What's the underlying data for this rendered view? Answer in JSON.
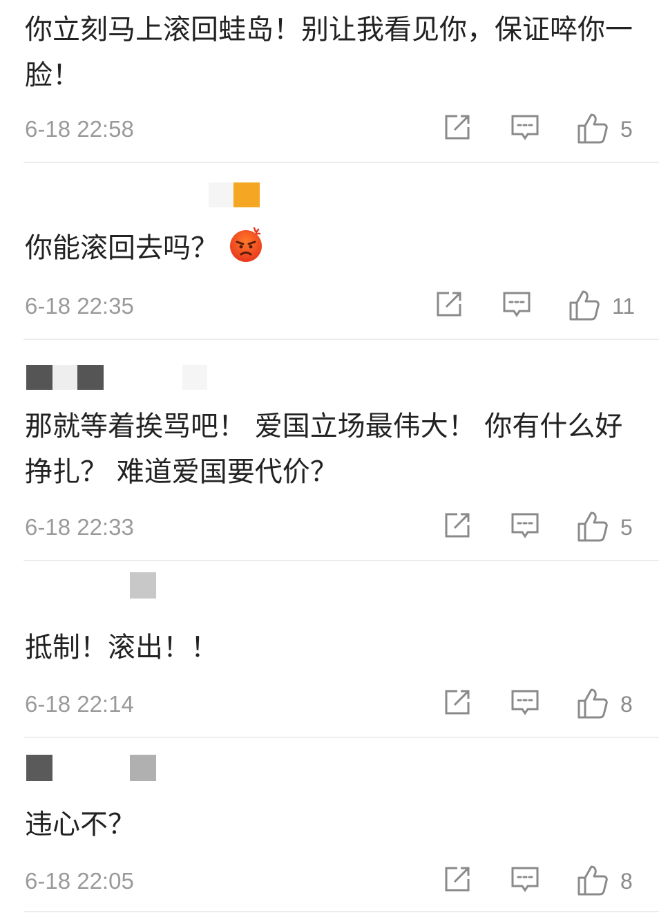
{
  "comments": [
    {
      "text": "你立刻马上滚回蛙岛！别让我看见你，保证啐你一脸！",
      "time": "6-18 22:58",
      "likes": "5"
    },
    {
      "text": "你能滚回去吗？",
      "time": "6-18 22:35",
      "likes": "11",
      "emoji": "angry-face-emoji"
    },
    {
      "text": "那就等着挨骂吧！ 爱国立场最伟大！ 你有什么好挣扎？ 难道爱国要代价？",
      "time": "6-18 22:33",
      "likes": "5"
    },
    {
      "text": "抵制！滚出！！",
      "time": "6-18 22:14",
      "likes": "8"
    },
    {
      "text": "违心不？",
      "time": "6-18 22:05",
      "likes": "8"
    }
  ],
  "icons": {
    "repost": "repost-icon",
    "reply": "comment-icon",
    "like": "thumbs-up-icon"
  },
  "colors": {
    "text": "#222222",
    "meta": "#9a9a9a",
    "divider": "#ececec",
    "censor_orange": "#f5a623"
  }
}
